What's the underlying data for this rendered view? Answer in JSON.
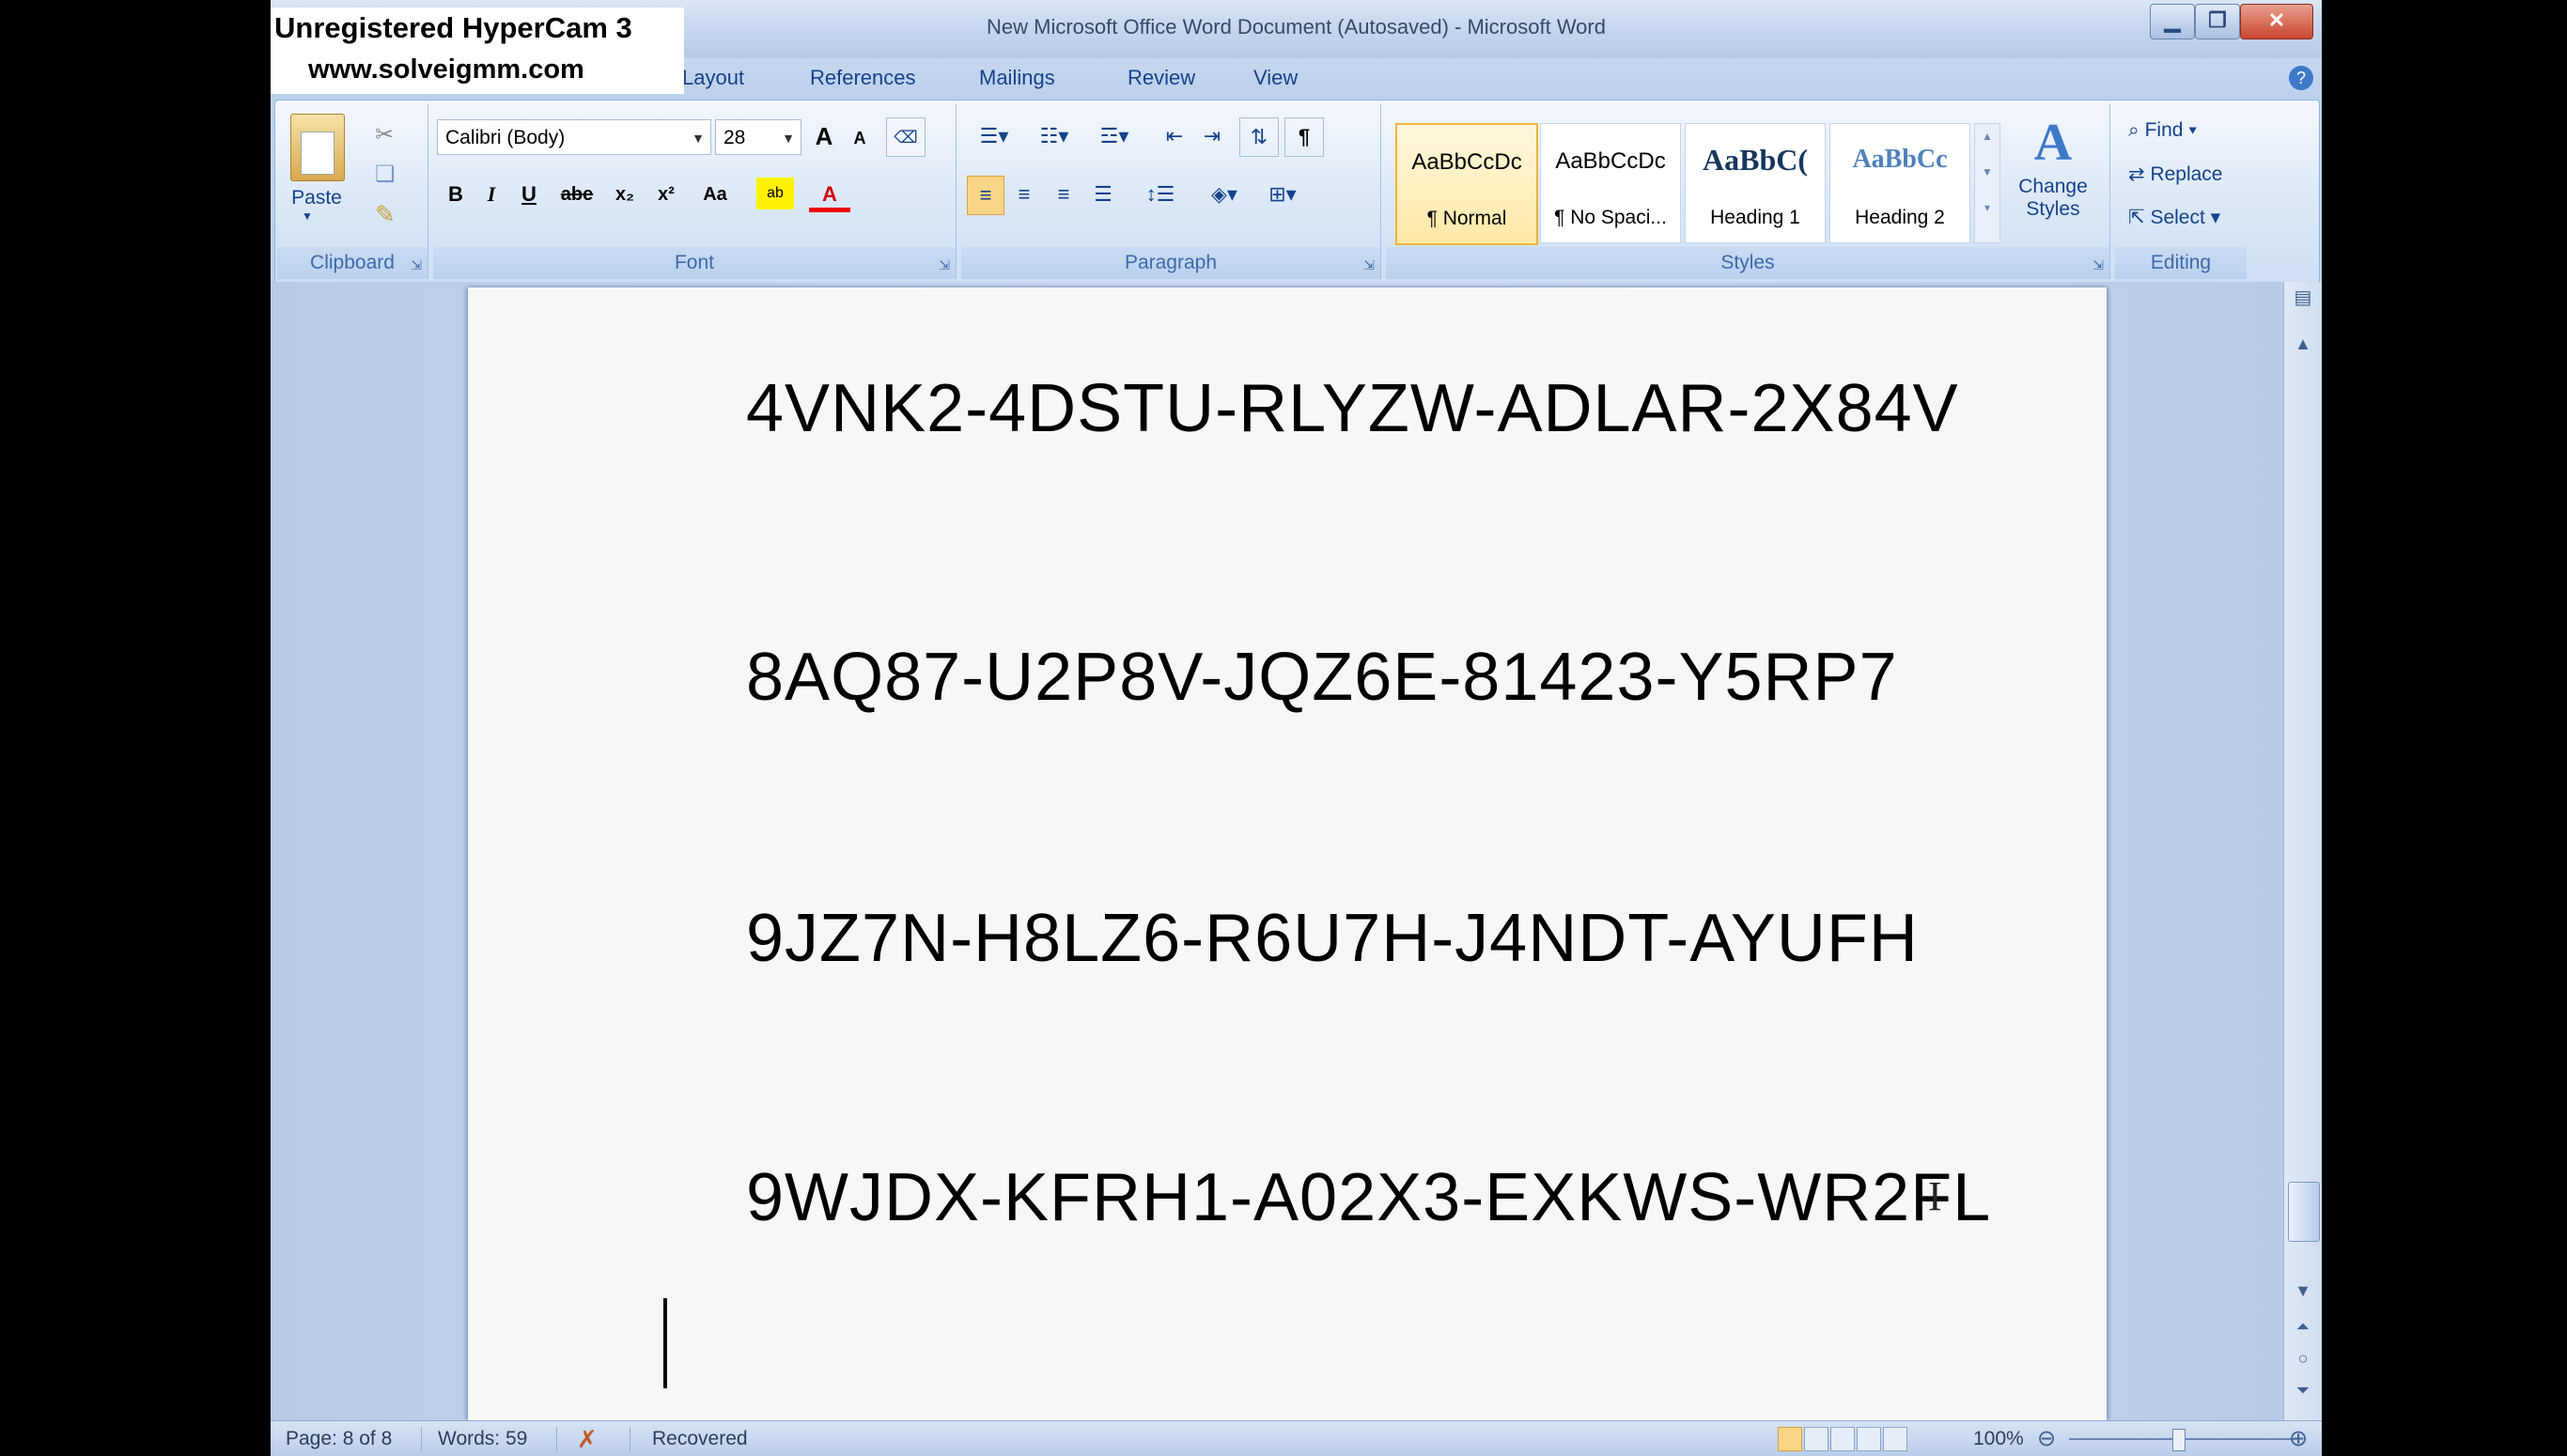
{
  "watermark": {
    "line1": "Unregistered HyperCam 3",
    "line2": "www.solveigmm.com"
  },
  "window": {
    "title": "New Microsoft Office Word Document (Autosaved) - Microsoft Word"
  },
  "tabs": [
    "Layout",
    "References",
    "Mailings",
    "Review",
    "View"
  ],
  "ribbon": {
    "clipboard": {
      "paste_label": "Paste",
      "group_label": "Clipboard"
    },
    "font": {
      "font_name": "Calibri (Body)",
      "font_size": "28",
      "group_label": "Font",
      "bold": "B",
      "italic": "I",
      "underline": "U",
      "strike": "abe",
      "sub": "x₂",
      "sup": "x²",
      "case": "Aa",
      "grow": "A",
      "shrink": "A",
      "color": "A"
    },
    "paragraph": {
      "group_label": "Paragraph"
    },
    "styles": {
      "group_label": "Styles",
      "items": [
        {
          "preview": "AaBbCcDc",
          "name": "¶ Normal"
        },
        {
          "preview": "AaBbCcDc",
          "name": "¶ No Spaci..."
        },
        {
          "preview": "AaBbC(",
          "name": "Heading 1"
        },
        {
          "preview": "AaBbCc",
          "name": "Heading 2"
        }
      ],
      "change_styles": "Change Styles"
    },
    "editing": {
      "group_label": "Editing",
      "find": "Find",
      "replace": "Replace",
      "select": "Select"
    }
  },
  "document": {
    "lines": [
      "4VNK2-4DSTU-RLYZW-ADLAR-2X84V",
      "8AQ87-U2P8V-JQZ6E-81423-Y5RP7",
      "9JZ7N-H8LZ6-R6U7H-J4NDT-AYUFH",
      "9WJDX-KFRH1-A02X3-EXKWS-WR2FL"
    ]
  },
  "status": {
    "page": "Page: 8 of 8",
    "words": "Words: 59",
    "recovered": "Recovered",
    "zoom": "100%"
  },
  "colors": {
    "ribbon_bg": "#dce8f7",
    "title_text": "#35496b",
    "close_button": "#c9452e",
    "style_selected": "#f0b23a"
  }
}
